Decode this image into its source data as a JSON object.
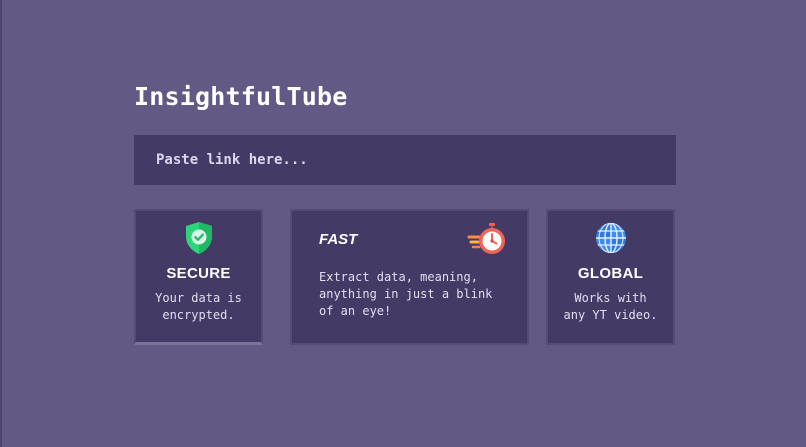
{
  "app": {
    "title": "InsightfulTube"
  },
  "link_input": {
    "placeholder": "Paste link here..."
  },
  "features": {
    "secure": {
      "icon": "shield-check-icon",
      "title": "SECURE",
      "desc_line1": "Your data is",
      "desc_line2": "encrypted."
    },
    "fast": {
      "icon": "stopwatch-icon",
      "title": "FAST",
      "desc_line1": "Extract data, meaning,",
      "desc_line2": "anything in just a blink",
      "desc_line3": "of an eye!"
    },
    "global": {
      "icon": "globe-icon",
      "title": "GLOBAL",
      "desc_line1": "Works with",
      "desc_line2": "any YT video."
    }
  },
  "colors": {
    "background": "#625a85",
    "panel": "#433a66",
    "shield_green": "#2ed47a",
    "stopwatch_red": "#f0645a",
    "globe_blue": "#3c8cf0"
  }
}
